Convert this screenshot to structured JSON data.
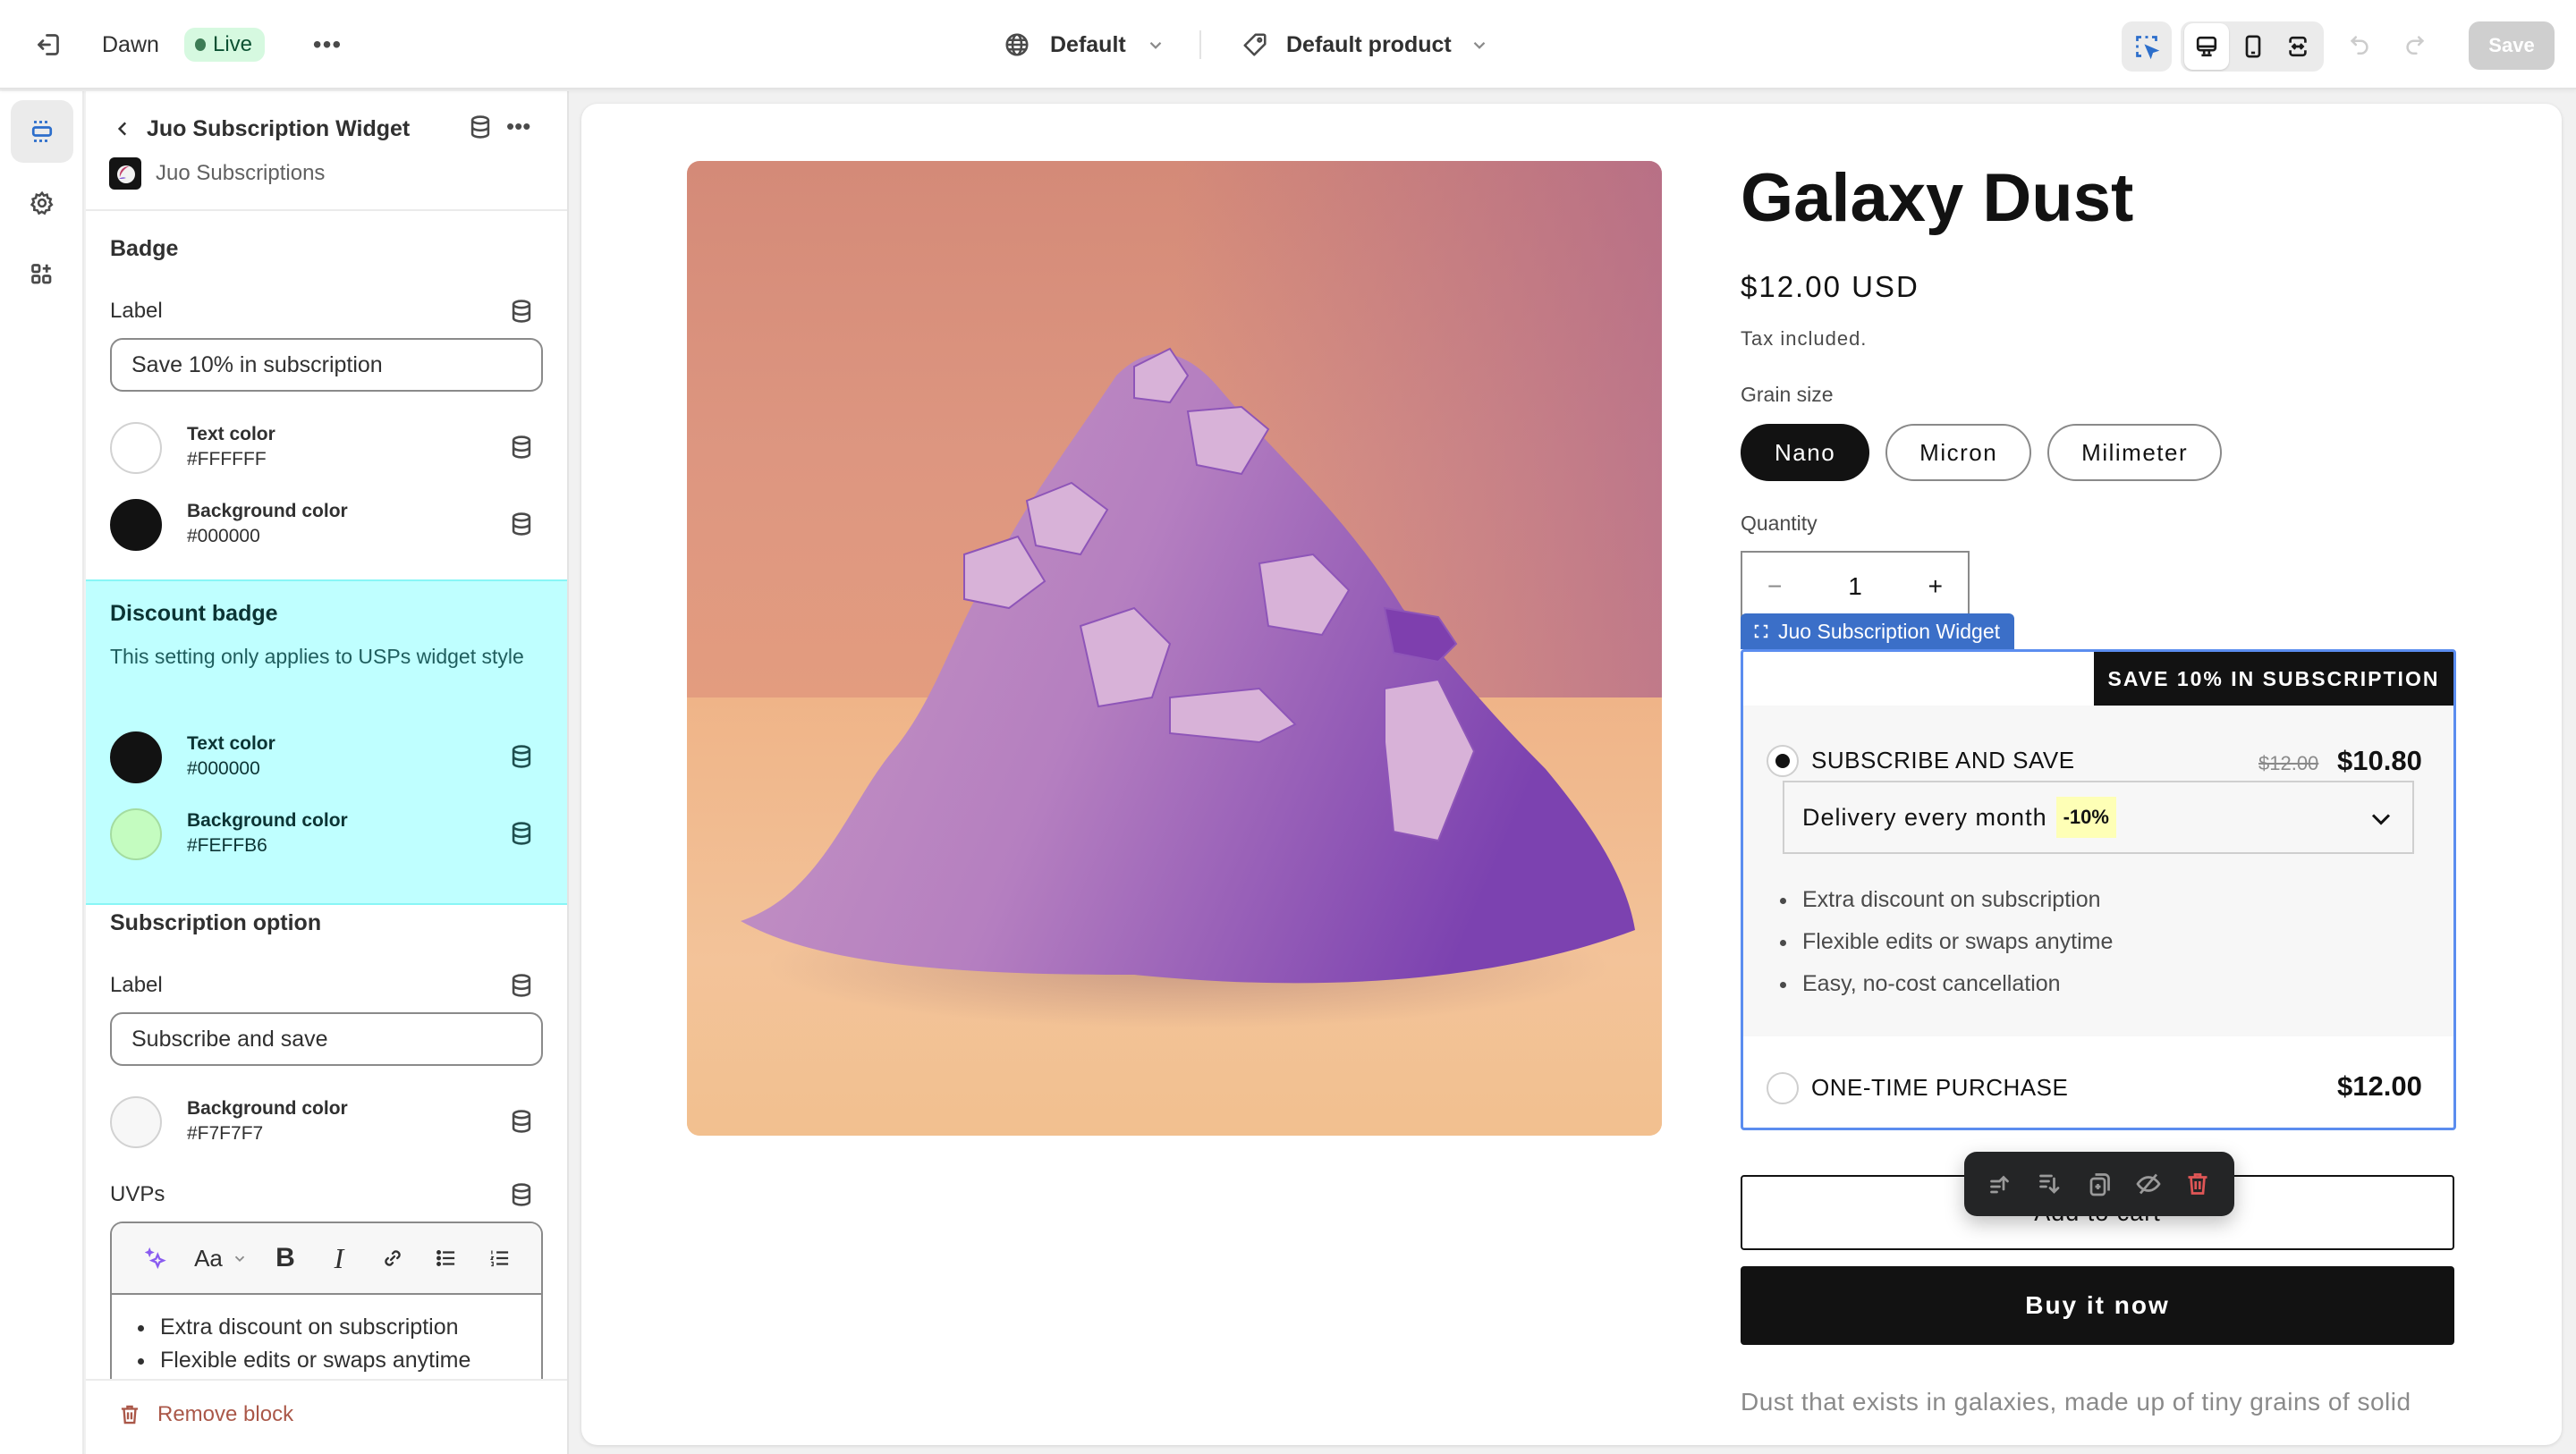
{
  "topbar": {
    "theme_name": "Dawn",
    "status_badge": "Live",
    "more_label": "•••",
    "language_selector": "Default",
    "template_selector": "Default product",
    "save_label": "Save",
    "icons": [
      "exit-icon",
      "globe-icon",
      "tag-icon",
      "inspector-icon",
      "desktop-icon",
      "mobile-icon",
      "fullscreen-icon",
      "undo-icon",
      "redo-icon"
    ]
  },
  "rail": {
    "items": [
      {
        "name": "sections",
        "icon": "sections-icon",
        "active": true
      },
      {
        "name": "theme-settings",
        "icon": "gear-icon",
        "active": false
      },
      {
        "name": "app-embeds",
        "icon": "apps-icon",
        "active": false
      }
    ]
  },
  "panel": {
    "title": "Juo Subscription Widget",
    "app_name": "Juo Subscriptions",
    "badge": {
      "heading": "Badge",
      "label_title": "Label",
      "label_value": "Save 10% in subscription",
      "text_color_name": "Text color",
      "text_color_value": "#FFFFFF",
      "bg_color_name": "Background color",
      "bg_color_value": "#000000"
    },
    "discount_badge": {
      "heading": "Discount badge",
      "description": "This setting only applies to USPs widget style",
      "text_color_name": "Text color",
      "text_color_value": "#000000",
      "bg_color_name": "Background color",
      "bg_color_value": "#FEFFB6"
    },
    "subscription_option": {
      "heading": "Subscription option",
      "label_title": "Label",
      "label_value": "Subscribe and save",
      "bg_color_name": "Background color",
      "bg_color_value": "#F7F7F7",
      "uvps_title": "UVPs",
      "uvps": [
        "Extra discount on subscription",
        "Flexible edits or swaps anytime"
      ]
    },
    "rte_tools": {
      "ai": "✦",
      "font": "Aa",
      "bold": "B",
      "italic": "I"
    },
    "remove_block": "Remove block"
  },
  "preview": {
    "product_title": "Galaxy Dust",
    "price": "$12.00 USD",
    "tax_note": "Tax included.",
    "variant_label": "Grain size",
    "variants": [
      {
        "label": "Nano",
        "selected": true
      },
      {
        "label": "Micron",
        "selected": false
      },
      {
        "label": "Milimeter",
        "selected": false
      }
    ],
    "quantity_label": "Quantity",
    "quantity_value": "1",
    "qty_minus": "−",
    "qty_plus": "+",
    "widget_tag": "Juo Subscription Widget",
    "widget": {
      "badge": "SAVE 10% IN SUBSCRIPTION",
      "subscribe_label": "SUBSCRIBE AND SAVE",
      "subscribe_old_price": "$12.00",
      "subscribe_price": "$10.80",
      "subscribe_selected": true,
      "delivery_option": "Delivery every month",
      "delivery_discount": "-10%",
      "uvps": [
        "Extra discount on subscription",
        "Flexible edits or swaps anytime",
        "Easy, no-cost cancellation"
      ],
      "onetime_label": "ONE-TIME PURCHASE",
      "onetime_price": "$12.00"
    },
    "add_to_cart": "Add to cart",
    "buy_now": "Buy it now",
    "description": "Dust that exists in galaxies, made up of tiny grains of solid",
    "block_toolbar": [
      "move-up-icon",
      "move-down-icon",
      "duplicate-icon",
      "hide-icon",
      "delete-icon"
    ]
  },
  "colors": {
    "accent_blue": "#3b6fc8",
    "selection_highlight": "#bffefe",
    "live_green": "#d6f9e0",
    "danger": "#e05656"
  }
}
